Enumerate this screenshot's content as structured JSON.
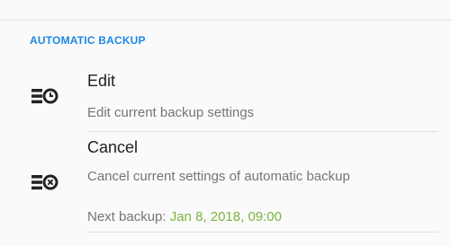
{
  "section": {
    "title": "AUTOMATIC BACKUP"
  },
  "items": [
    {
      "icon": "backup-edit-icon",
      "title": "Edit",
      "subtitle": "Edit current backup settings"
    },
    {
      "icon": "backup-cancel-icon",
      "title": "Cancel",
      "subtitle": "Cancel current settings of automatic backup"
    }
  ],
  "next_backup": {
    "label": "Next backup: ",
    "value": "Jan 8, 2018, 09:00"
  },
  "colors": {
    "accent": "#1e88e5",
    "date": "#7cb342",
    "primary_text": "#212121",
    "secondary_text": "#757575"
  }
}
